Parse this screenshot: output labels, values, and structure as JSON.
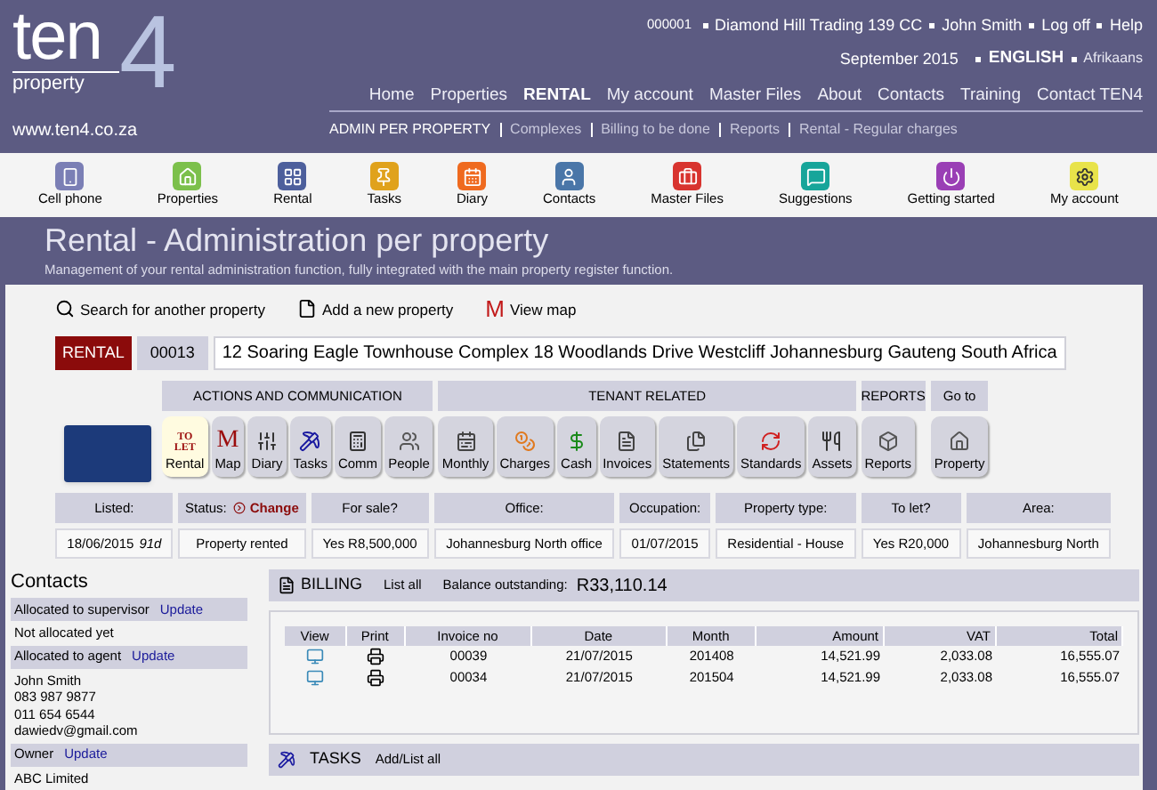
{
  "logo": {
    "word": "ten",
    "numeral": "4",
    "tagline": "property"
  },
  "header": {
    "website": "www.ten4.co.za",
    "account_bar": [
      "000001",
      "Diamond Hill Trading 139 CC",
      "John Smith",
      "Log off",
      "Help"
    ],
    "period": "September 2015",
    "languages": [
      {
        "label": "ENGLISH",
        "selected": true
      },
      {
        "label": "Afrikaans",
        "selected": false
      }
    ],
    "nav": [
      {
        "label": "Home",
        "selected": false
      },
      {
        "label": "Properties",
        "selected": false
      },
      {
        "label": "RENTAL",
        "selected": true
      },
      {
        "label": "My account",
        "selected": false
      },
      {
        "label": "Master Files",
        "selected": false
      },
      {
        "label": "About",
        "selected": false
      },
      {
        "label": "Contacts",
        "selected": false
      },
      {
        "label": "Training",
        "selected": false
      },
      {
        "label": "Contact TEN4",
        "selected": false
      }
    ],
    "subnav": [
      {
        "label": "ADMIN PER PROPERTY",
        "selected": true
      },
      {
        "label": "Complexes",
        "selected": false
      },
      {
        "label": "Billing to be done",
        "selected": false
      },
      {
        "label": "Reports",
        "selected": false
      },
      {
        "label": "Rental - Regular charges",
        "selected": false
      }
    ]
  },
  "app_bar": [
    {
      "label": "Cell phone",
      "color": "#7b7fb5"
    },
    {
      "label": "Properties",
      "color": "#7cc04b"
    },
    {
      "label": "Rental",
      "color": "#4d5f9c"
    },
    {
      "label": "Tasks",
      "color": "#e0a21c"
    },
    {
      "label": "Diary",
      "color": "#ef6a1f"
    },
    {
      "label": "Contacts",
      "color": "#4a76a8"
    },
    {
      "label": "Master Files",
      "color": "#d8342f"
    },
    {
      "label": "Suggestions",
      "color": "#17a59a"
    },
    {
      "label": "Getting started",
      "color": "#9a3fb5"
    },
    {
      "label": "My account",
      "color": "#e8e34a"
    }
  ],
  "page": {
    "title": "Rental - Administration per property",
    "subtitle": "Management of your rental administration function, fully integrated with the main property register function."
  },
  "actions": [
    {
      "kind": "search",
      "label": "Search for another property"
    },
    {
      "kind": "add",
      "label": "Add a new property"
    },
    {
      "kind": "map",
      "glyph": "M",
      "label": "View map"
    }
  ],
  "property": {
    "badge": "RENTAL",
    "code": "00013",
    "address": "12 Soaring Eagle Townhouse Complex 18 Woodlands Drive Westcliff Johannesburg Gauteng South Africa"
  },
  "sections": [
    {
      "label": "ACTIONS AND COMMUNICATION",
      "tiles": [
        {
          "label": "Rental",
          "glyph": "TO LET",
          "selected": true
        },
        {
          "label": "Map",
          "glyph": "M",
          "selected": false
        },
        {
          "label": "Diary",
          "selected": false
        },
        {
          "label": "Tasks",
          "selected": false
        },
        {
          "label": "Comm",
          "selected": false
        },
        {
          "label": "People",
          "selected": false
        }
      ]
    },
    {
      "label": "TENANT RELATED",
      "tiles": [
        {
          "label": "Monthly",
          "selected": false
        },
        {
          "label": "Charges",
          "selected": false
        },
        {
          "label": "Cash",
          "selected": false
        },
        {
          "label": "Invoices",
          "selected": false
        },
        {
          "label": "Statements",
          "selected": false
        },
        {
          "label": "Standards",
          "selected": false
        },
        {
          "label": "Assets",
          "selected": false
        }
      ]
    },
    {
      "label": "REPORTS",
      "tiles": [
        {
          "label": "Reports",
          "selected": false
        }
      ]
    },
    {
      "label": "Go to",
      "tiles": [
        {
          "label": "Property",
          "selected": false
        }
      ]
    }
  ],
  "info": [
    {
      "label": "Listed:",
      "value": "18/06/2015",
      "note": "91d"
    },
    {
      "label": "Status:",
      "action": "Change",
      "value": "Property rented"
    },
    {
      "label": "For sale?",
      "value": "Yes  R8,500,000"
    },
    {
      "label": "Office:",
      "value": "Johannesburg North office"
    },
    {
      "label": "Occupation:",
      "value": "01/07/2015"
    },
    {
      "label": "Property type:",
      "value": "Residential - House"
    },
    {
      "label": "To let?",
      "value": "Yes  R20,000"
    },
    {
      "label": "Area:",
      "value": "Johannesburg North"
    }
  ],
  "contacts": {
    "title": "Contacts",
    "groups": [
      {
        "label": "Allocated to supervisor",
        "action": "Update",
        "lines": [
          "Not allocated yet"
        ]
      },
      {
        "label": "Allocated to agent",
        "action": "Update",
        "lines": [
          "John Smith",
          "083 987 9877",
          "011 654 6544",
          "dawiedv@gmail.com"
        ]
      },
      {
        "label": "Owner",
        "action": "Update",
        "lines": [
          "ABC Limited"
        ]
      }
    ]
  },
  "billing": {
    "title": "BILLING",
    "link": "List all",
    "balance_label": "Balance outstanding:",
    "balance": "R33,110.14",
    "columns": [
      "View",
      "Print",
      "Invoice no",
      "Date",
      "Month",
      "Amount",
      "VAT",
      "Total"
    ],
    "rows": [
      {
        "invoice": "00039",
        "date": "21/07/2015",
        "month": "201408",
        "amount": "14,521.99",
        "vat": "2,033.08",
        "total": "16,555.07"
      },
      {
        "invoice": "00034",
        "date": "21/07/2015",
        "month": "201504",
        "amount": "14,521.99",
        "vat": "2,033.08",
        "total": "16,555.07"
      }
    ]
  },
  "tasks": {
    "title": "TASKS",
    "link": "Add/List all"
  }
}
